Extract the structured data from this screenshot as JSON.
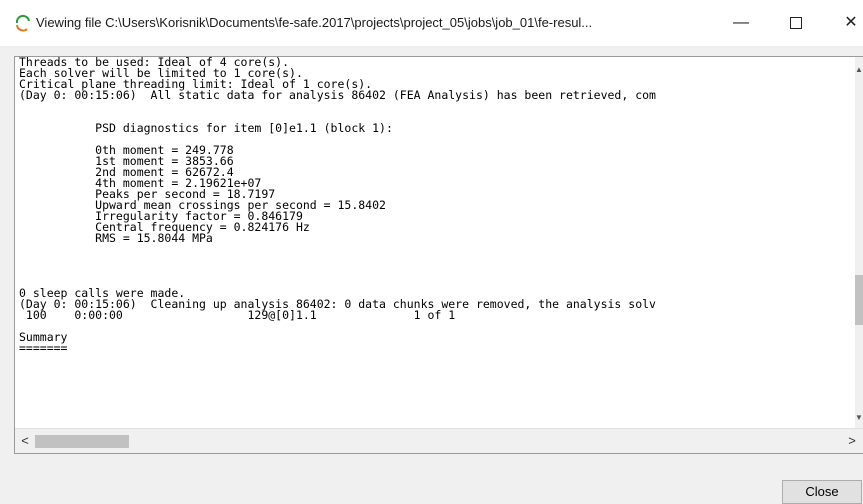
{
  "window": {
    "title": "Viewing file C:\\Users\\Korisnik\\Documents\\fe-safe.2017\\projects\\project_05\\jobs\\job_01\\fe-resul...",
    "icon": "fe-safe-app-icon",
    "minimize_glyph": "—",
    "close_glyph": "✕"
  },
  "log": {
    "lines": [
      "Threads to be used: Ideal of 4 core(s).",
      "Each solver will be limited to 1 core(s).",
      "Critical plane threading limit: Ideal of 1 core(s).",
      "(Day 0: 00:15:06)  All static data for analysis 86402 (FEA Analysis) has been retrieved, com",
      "",
      "",
      "           PSD diagnostics for item [0]e1.1 (block 1):",
      "",
      "           0th moment = 249.778",
      "           1st moment = 3853.66",
      "           2nd moment = 62672.4",
      "           4th moment = 2.19621e+07",
      "           Peaks per second = 18.7197",
      "           Upward mean crossings per second = 15.8402",
      "           Irregularity factor = 0.846179",
      "           Central frequency = 0.824176 Hz",
      "           RMS = 15.8044 MPa",
      "",
      "",
      "",
      "",
      "0 sleep calls were made.",
      "(Day 0: 00:15:06)  Cleaning up analysis 86402: 0 data chunks were removed, the analysis solv",
      " 100    0:00:00                  129@[0]1.1              1 of 1",
      "",
      "Summary",
      "======="
    ]
  },
  "scrollbar": {
    "left_arrow": "<",
    "right_arrow": ">",
    "up_arrow": "▲",
    "down_arrow": "▼"
  },
  "buttons": {
    "close_label": "Close"
  }
}
